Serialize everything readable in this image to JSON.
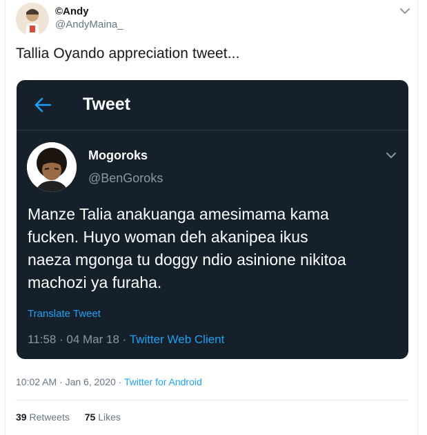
{
  "author": {
    "display_name": "©Andy",
    "handle": "@AndyMaina_"
  },
  "tweet": {
    "text": "Tallia Oyando appreciation tweet...",
    "timestamp": "10:02 AM · Jan 6, 2020 · ",
    "source": "Twitter for Android"
  },
  "stats": {
    "retweets_count": "39",
    "retweets_label": "Retweets",
    "likes_count": "75",
    "likes_label": "Likes"
  },
  "embed": {
    "header_title": "Tweet",
    "author_name": "Mogoroks",
    "author_handle": "@BenGoroks",
    "body_lines": [
      "Manze Talia anakuanga amesimama kama",
      "fucken. Huyo woman deh akanipea ikus",
      "naeza mgonga tu doggy ndio asinione nikitoa",
      "machozi ya furaha."
    ],
    "translate_label": "Translate Tweet",
    "meta_time": "11:58 · 04 Mar 18 · ",
    "meta_client": "Twitter Web Client"
  },
  "colors": {
    "accent": "#1da1f2",
    "dark_bg": "#15202b",
    "muted": "#657786"
  },
  "icons": [
    "avatar-image",
    "chevron-down-icon",
    "back-arrow-icon"
  ]
}
